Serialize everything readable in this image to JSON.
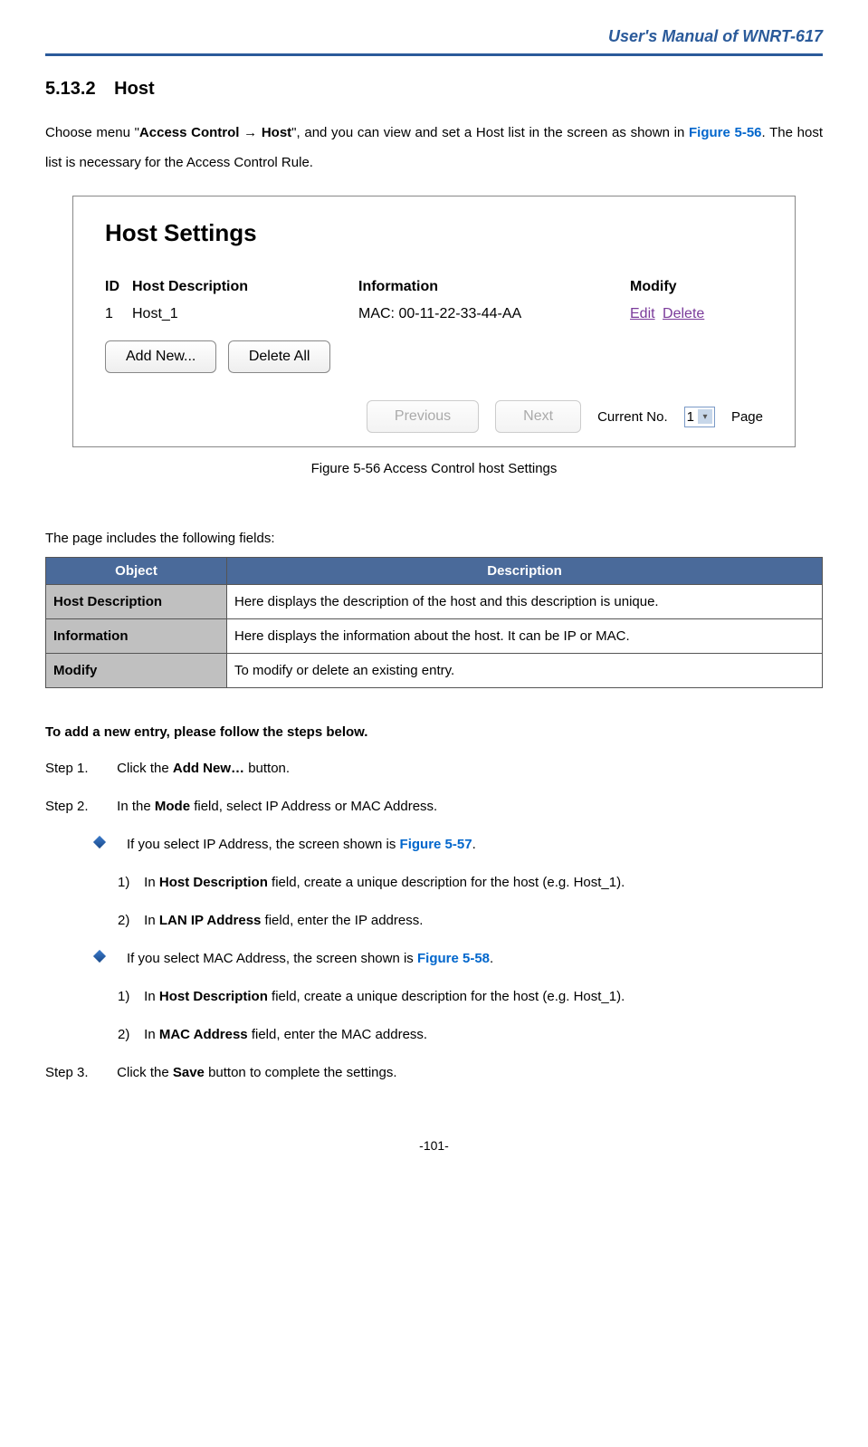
{
  "header": "User's  Manual  of  WNRT-617",
  "section": {
    "num": "5.13.2",
    "title": "Host"
  },
  "intro": {
    "pre": "Choose  menu  \"",
    "bold1": "Access  Control  →  Host",
    "mid": "\",  and  you  can  view  and  set  a  Host  list  in  the  screen  as shown in ",
    "figref": "Figure 5-56",
    "post": ". The host list is necessary for the Access Control Rule."
  },
  "screenshot": {
    "title": "Host Settings",
    "headers": {
      "id": "ID",
      "desc": "Host Description",
      "info": "Information",
      "modify": "Modify"
    },
    "row": {
      "id": "1",
      "desc": "Host_1",
      "info": "MAC: 00-11-22-33-44-AA",
      "edit": "Edit",
      "del": "Delete"
    },
    "addnew": "Add New...",
    "deleteall": "Delete All",
    "prev": "Previous",
    "next": "Next",
    "current": "Current No.",
    "page": "Page",
    "pagenum": "1"
  },
  "caption": {
    "fig": "Figure 5-56",
    "text": "    Access Control host Settings"
  },
  "fieldsIntro": "The page includes the following fields:",
  "table": {
    "h1": "Object",
    "h2": "Description",
    "rows": [
      {
        "obj": "Host Description",
        "desc": "Here displays the description of the host and this description is unique."
      },
      {
        "obj": "Information",
        "desc": "Here displays the information about the host. It can be IP or MAC."
      },
      {
        "obj": "Modify",
        "desc": "To modify or delete an existing entry."
      }
    ]
  },
  "addTitle": "To add a new entry, please follow the steps below.",
  "steps": {
    "s1": {
      "label": "Step 1.",
      "pre": "Click the ",
      "bold": "Add New…",
      "post": " button."
    },
    "s2": {
      "label": "Step 2.",
      "pre": "In the ",
      "bold": "Mode",
      "post": " field, select IP Address or MAC Address."
    },
    "b1": {
      "pre": "If you select IP Address, the screen shown is ",
      "ref": "Figure 5-57",
      "post": "."
    },
    "n1a": {
      "num": "1)",
      "pre": "In ",
      "bold": "Host Description",
      "post": " field, create a unique description for the host (e.g. Host_1)."
    },
    "n1b": {
      "num": "2)",
      "pre": "In ",
      "bold": "LAN IP Address",
      "post": " field, enter the IP address."
    },
    "b2": {
      "pre": "If you select MAC Address, the screen shown is ",
      "ref": "Figure 5-58",
      "post": "."
    },
    "n2a": {
      "num": "1)",
      "pre": "In ",
      "bold": "Host Description",
      "post": " field, create a unique description for the host (e.g. Host_1)."
    },
    "n2b": {
      "num": "2)",
      "pre": "In ",
      "bold": "MAC Address",
      "post": " field, enter the MAC address."
    },
    "s3": {
      "label": "Step 3.",
      "pre": "Click the ",
      "bold": "Save",
      "post": " button to complete the settings."
    }
  },
  "pageNum": "-101-"
}
